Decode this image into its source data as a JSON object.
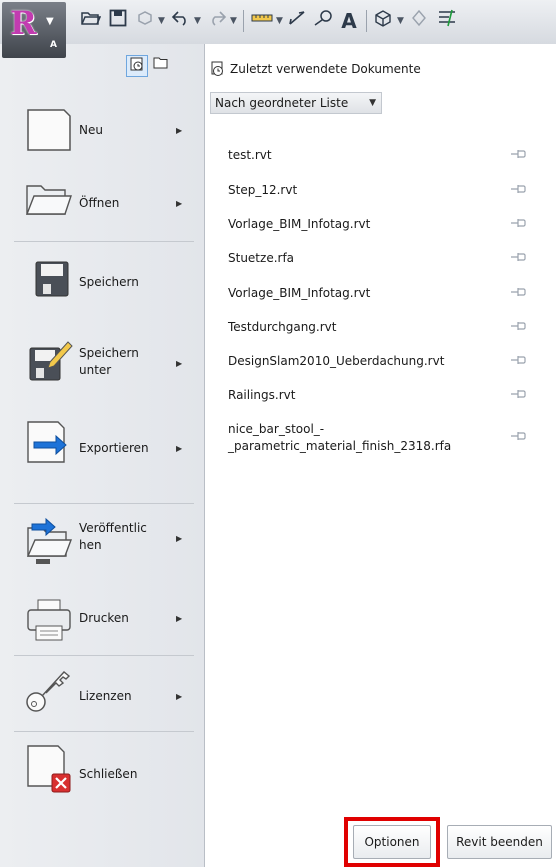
{
  "app": {
    "logo_letter": "R",
    "sub_letter": "A"
  },
  "quick_access": {
    "icons": [
      "open-icon",
      "save-icon",
      "sync-icon",
      "undo-icon",
      "redo-icon",
      "measure-icon",
      "dimension-icon",
      "tag-icon",
      "text-icon",
      "3d-view-icon",
      "section-icon",
      "thin-lines-icon"
    ]
  },
  "left_menu": {
    "items": [
      {
        "id": "neu",
        "label": "Neu",
        "has_submenu": true
      },
      {
        "id": "oeffnen",
        "label": "Öffnen",
        "has_submenu": true
      },
      {
        "id": "speichern",
        "label": "Speichern",
        "has_submenu": false
      },
      {
        "id": "speichern-unter",
        "label_line1": "Speichern",
        "label_line2": "unter",
        "has_submenu": true
      },
      {
        "id": "exportieren",
        "label": "Exportieren",
        "has_submenu": true
      },
      {
        "id": "veroeffentlichen",
        "label_line1": "Veröffentlic",
        "label_line2": "hen",
        "has_submenu": true
      },
      {
        "id": "drucken",
        "label": "Drucken",
        "has_submenu": true
      },
      {
        "id": "lizenzen",
        "label": "Lizenzen",
        "has_submenu": true
      },
      {
        "id": "schliessen",
        "label": "Schließen",
        "has_submenu": false
      }
    ]
  },
  "recent": {
    "title": "Zuletzt verwendete Dokumente",
    "sort_value": "Nach geordneter Liste",
    "files": [
      {
        "name": "test.rvt"
      },
      {
        "name": "Step_12.rvt"
      },
      {
        "name": "Vorlage_BIM_Infotag.rvt"
      },
      {
        "name": "Stuetze.rfa"
      },
      {
        "name": "Vorlage_BIM_Infotag.rvt"
      },
      {
        "name": "Testdurchgang.rvt"
      },
      {
        "name": "DesignSlam2010_Ueberdachung.rvt"
      },
      {
        "name": "Railings.rvt"
      },
      {
        "name_line1": "nice_bar_stool_-",
        "name_line2": "_parametric_material_finish_2318.rfa"
      }
    ]
  },
  "buttons": {
    "options": "Optionen",
    "exit": "Revit beenden"
  },
  "colors": {
    "highlight": "#e00000",
    "logo": "#c23bb0",
    "export_arrow": "#1e73d8",
    "close_badge": "#d83030"
  }
}
